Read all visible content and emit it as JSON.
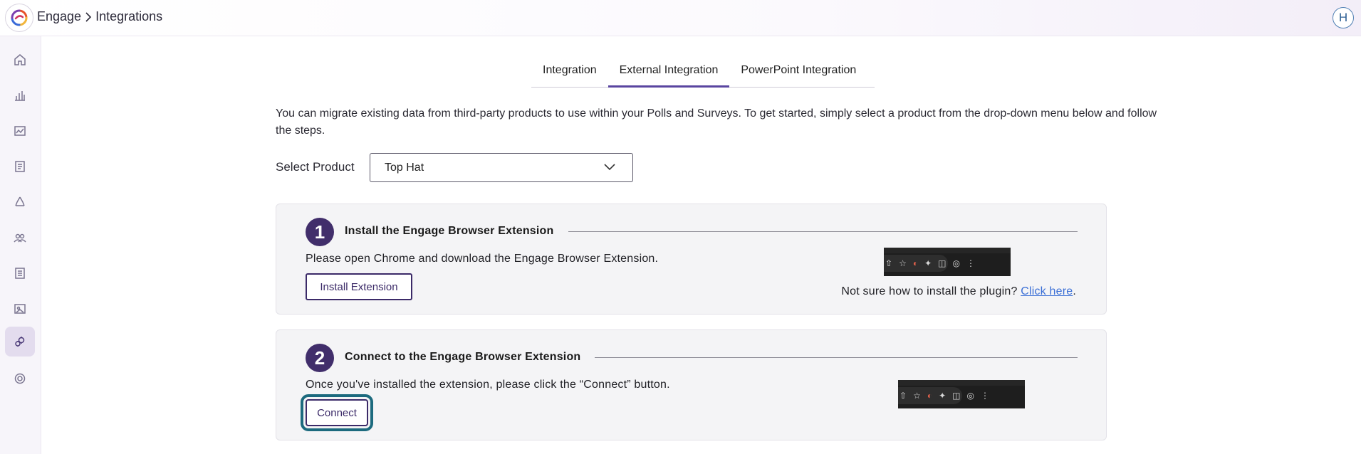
{
  "header": {
    "app_name": "Engage",
    "page_name": "Integrations",
    "user_initial": "H"
  },
  "sidebar": {
    "items": [
      {
        "icon": "home-icon"
      },
      {
        "icon": "bar-chart-icon"
      },
      {
        "icon": "analytics-icon"
      },
      {
        "icon": "report-icon"
      },
      {
        "icon": "recycle-icon"
      },
      {
        "icon": "users-icon"
      },
      {
        "icon": "document-icon"
      },
      {
        "icon": "gallery-icon"
      },
      {
        "icon": "integrations-icon",
        "active": true
      },
      {
        "icon": "settings-icon"
      }
    ]
  },
  "tabs": [
    {
      "label": "Integration"
    },
    {
      "label": "External Integration",
      "active": true
    },
    {
      "label": "PowerPoint Integration"
    }
  ],
  "intro": "You can migrate existing data from third-party products to use within your Polls and Surveys. To get started, simply select a product from the drop-down menu below and follow the steps.",
  "product_select": {
    "label": "Select Product",
    "value": "Top Hat"
  },
  "steps": [
    {
      "number": "1",
      "title": "Install the Engage Browser Extension",
      "description": "Please open Chrome and download the Engage Browser Extension.",
      "button_label": "Install Extension",
      "help_text": "Not sure how to install the plugin?",
      "help_link": "Click here",
      "help_suffix": "."
    },
    {
      "number": "2",
      "title": "Connect to the Engage Browser Extension",
      "description": "Once you've installed the extension, please click the “Connect” button.",
      "button_label": "Connect"
    }
  ],
  "colors": {
    "accent": "#412e6b",
    "tab_underline": "#5a45a0",
    "focus_ring": "#1c6a7e",
    "link": "#3b6fd6"
  }
}
